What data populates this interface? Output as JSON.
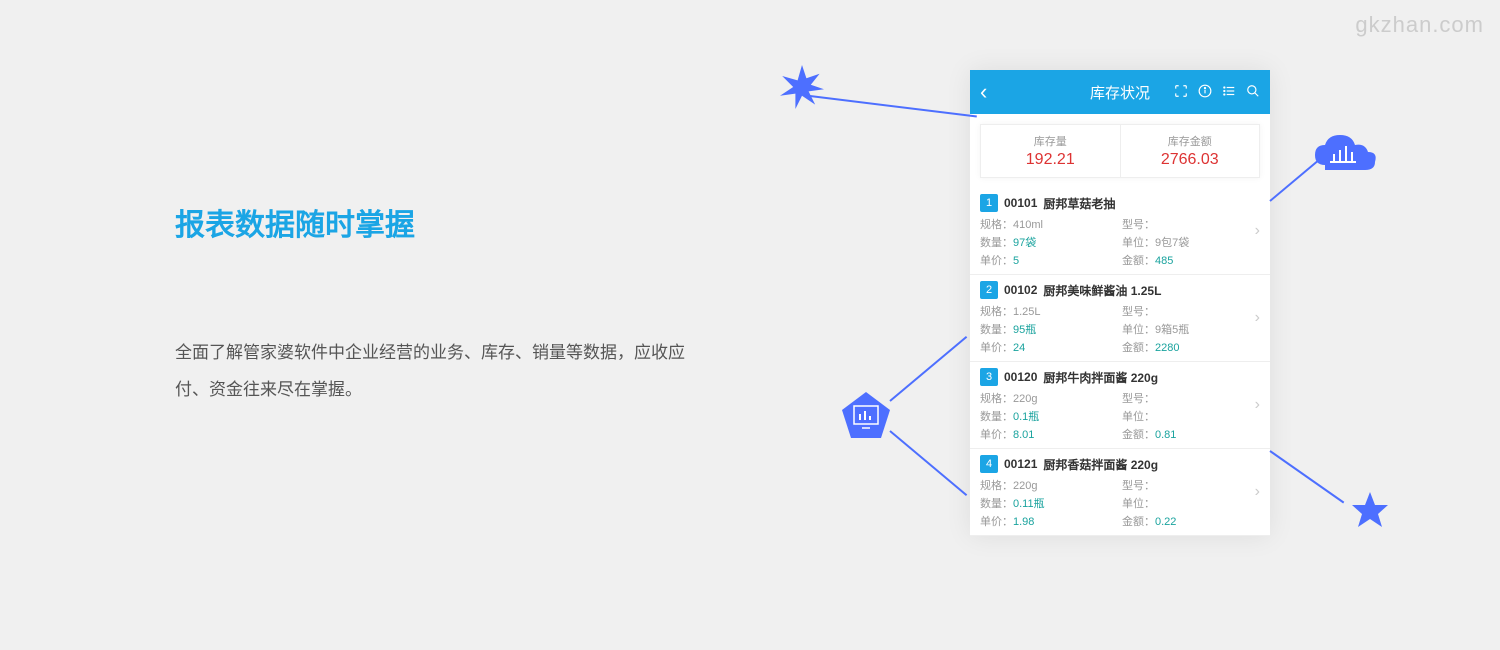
{
  "watermark": "gkzhan.com",
  "left": {
    "title": "报表数据随时掌握",
    "description": "全面了解管家婆软件中企业经营的业务、库存、销量等数据，应收应付、资金往来尽在掌握。"
  },
  "phone": {
    "title": "库存状况",
    "summary": {
      "stock_label": "库存量",
      "stock_value": "192.21",
      "amount_label": "库存金额",
      "amount_value": "2766.03"
    },
    "labels": {
      "spec": "规格：",
      "model": "型号：",
      "qty": "数量：",
      "unit": "单位：",
      "price": "单价：",
      "amount": "金额："
    },
    "items": [
      {
        "idx": "1",
        "code": "00101",
        "name": "厨邦草菇老抽",
        "spec": "410ml",
        "model": "",
        "qty": "97袋",
        "unit": "9包7袋",
        "price": "5",
        "amount": "485"
      },
      {
        "idx": "2",
        "code": "00102",
        "name": "厨邦美味鲜酱油 1.25L",
        "spec": "1.25L",
        "model": "",
        "qty": "95瓶",
        "unit": "9箱5瓶",
        "price": "24",
        "amount": "2280"
      },
      {
        "idx": "3",
        "code": "00120",
        "name": "厨邦牛肉拌面酱 220g",
        "spec": "220g",
        "model": "",
        "qty": "0.1瓶",
        "unit": "",
        "price": "8.01",
        "amount": "0.81"
      },
      {
        "idx": "4",
        "code": "00121",
        "name": "厨邦香菇拌面酱 220g",
        "spec": "220g",
        "model": "",
        "qty": "0.11瓶",
        "unit": "",
        "price": "1.98",
        "amount": "0.22"
      }
    ]
  }
}
